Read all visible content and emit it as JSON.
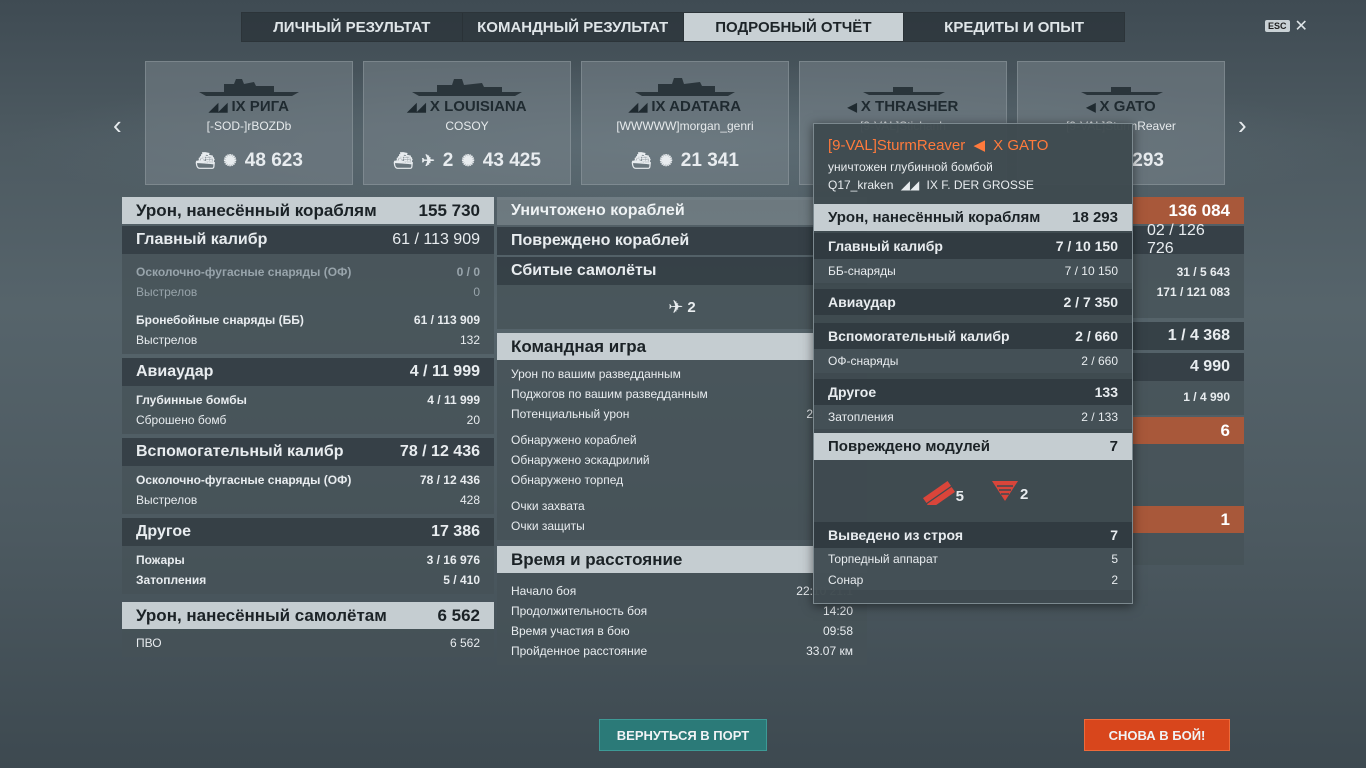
{
  "tabs": [
    "ЛИЧНЫЙ РЕЗУЛЬТАТ",
    "КОМАНДНЫЙ РЕЗУЛЬТАТ",
    "ПОДРОБНЫЙ ОТЧЁТ",
    "КРЕДИТЫ И ОПЫТ"
  ],
  "active_tab": "ПОДРОБНЫЙ ОТЧЁТ",
  "esc": "ESC",
  "ships": [
    {
      "name": "IX РИГА",
      "player": "[-SOD-]rBOZDb",
      "planes": "",
      "damage": "48 623"
    },
    {
      "name": "X LOUISIANA",
      "player": "COSOY",
      "planes": "2",
      "damage": "43 425"
    },
    {
      "name": "IX ADATARA",
      "player": "[WWWWW]morgan_genri",
      "planes": "",
      "damage": "21 341"
    },
    {
      "name": "X THRASHER",
      "player": "[9-VAL]Stichanh",
      "planes": "",
      "damage": ""
    },
    {
      "name": "X GATO",
      "player": "[9-VAL]SturmReaver",
      "planes": "",
      "damage": "293"
    }
  ],
  "left": {
    "total_label": "Урон, нанесённый кораблям",
    "total_value": "155 730",
    "main_label": "Главный калибр",
    "main_value": "61 / 113 909",
    "he_label": "Осколочно-фугасные снаряды (ОФ)",
    "he_value": "0 / 0",
    "he_shots_label": "Выстрелов",
    "he_shots": "0",
    "ap_label": "Бронебойные снаряды (ББ)",
    "ap_value": "61 / 113 909",
    "ap_shots_label": "Выстрелов",
    "ap_shots": "132",
    "air_label": "Авиаудар",
    "air_value": "4 / 11 999",
    "depth_label": "Глубинные бомбы",
    "depth_value": "4 / 11 999",
    "bombs_label": "Сброшено бомб",
    "bombs_value": "20",
    "sec_label": "Вспомогательный калибр",
    "sec_value": "78 / 12 436",
    "sec_he_label": "Осколочно-фугасные снаряды (ОФ)",
    "sec_he_value": "78 / 12 436",
    "sec_shots_label": "Выстрелов",
    "sec_shots": "428",
    "other_label": "Другое",
    "other_value": "17 386",
    "fires_label": "Пожары",
    "fires_value": "3 / 16 976",
    "flood_label": "Затопления",
    "flood_value": "5 / 410",
    "planes_label": "Урон, нанесённый самолётам",
    "planes_value": "6 562",
    "aa_label": "ПВО",
    "aa_value": "6 562"
  },
  "middle": {
    "destroyed": "Уничтожено кораблей",
    "damaged": "Повреждено кораблей",
    "shot_planes": "Сбитые самолёты",
    "shot_planes_count": "2",
    "team": "Командная игра",
    "spot_dmg": "Урон по вашим разведданным",
    "spot_fire": "Поджогов по вашим разведданным",
    "potential": "Потенциальный урон",
    "potential_value": "2 4",
    "ships_spotted": "Обнаружено кораблей",
    "squads_spotted": "Обнаружено эскадрилий",
    "torps_spotted": "Обнаружено торпед",
    "capture": "Очки захвата",
    "defense": "Очки защиты",
    "time": "Время и расстояние",
    "start": "Начало боя",
    "start_value": "22:10  21.1",
    "duration": "Продолжительность боя",
    "duration_value": "14:20",
    "participation": "Время участия в бою",
    "participation_value": "09:58",
    "distance": "Пройденное расстояние",
    "distance_value": "33.07 км"
  },
  "right": {
    "total": "136 084",
    "main": "02 / 126 726",
    "r1": "31 / 5 643",
    "r2": "171 / 121 083",
    "air": "1 / 4 368",
    "sec": "4 990",
    "sec_row": "1 / 4 990",
    "six": "6",
    "one": "1"
  },
  "tooltip": {
    "player": "[9-VAL]SturmReaver",
    "ship": "X GATO",
    "desc": "уничтожен глубинной бомбой",
    "by_player": "Q17_kraken",
    "by_ship": "IX F. DER GROSSE",
    "total_label": "Урон, нанесённый кораблям",
    "total_value": "18 293",
    "main_label": "Главный калибр",
    "main_value": "7 / 10 150",
    "ap_label": "ББ-снаряды",
    "ap_value": "7 / 10 150",
    "air_label": "Авиаудар",
    "air_value": "2 / 7 350",
    "sec_label": "Вспомогательный калибр",
    "sec_value": "2 / 660",
    "he_label": "ОФ-снаряды",
    "he_value": "2 / 660",
    "other_label": "Другое",
    "other_value": "133",
    "flood_label": "Затопления",
    "flood_value": "2 / 133",
    "modules_label": "Повреждено модулей",
    "modules_value": "7",
    "mod1": "5",
    "mod2": "2",
    "disabled_label": "Выведено из строя",
    "disabled_value": "7",
    "torp_label": "Торпедный аппарат",
    "torp_value": "5",
    "sonar_label": "Сонар",
    "sonar_value": "2"
  },
  "buttons": {
    "port": "ВЕРНУТЬСЯ В ПОРТ",
    "again": "СНОВА В БОЙ!"
  },
  "colors": {
    "accent": "#ff7a3c",
    "port_btn": "#2b7a78",
    "again_btn": "#d8461c",
    "right_bar": "#a8583a"
  }
}
